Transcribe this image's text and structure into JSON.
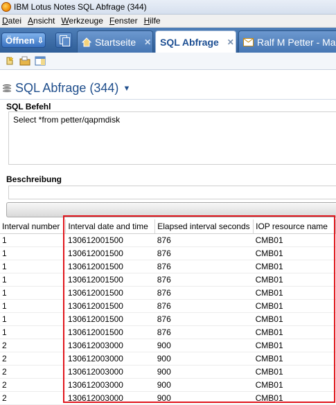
{
  "window": {
    "title": "IBM Lotus Notes SQL Abfrage (344)"
  },
  "menu": [
    {
      "underline": "D",
      "rest": "atei"
    },
    {
      "underline": "A",
      "rest": "nsicht"
    },
    {
      "underline": "W",
      "rest": "erkzeuge"
    },
    {
      "underline": "F",
      "rest": "enster"
    },
    {
      "underline": "H",
      "rest": "ilfe"
    }
  ],
  "toolbar": {
    "open_label": "Öffnen"
  },
  "tabs": [
    {
      "label": "Startseite",
      "icon": "home-icon",
      "active": false
    },
    {
      "label": "SQL Abfrage",
      "icon": "",
      "active": true
    },
    {
      "label": "Ralf M Petter - Mail",
      "icon": "mail-icon",
      "active": false
    }
  ],
  "view": {
    "title": "SQL Abfrage (344)",
    "sql_label": "SQL Befehl",
    "sql_text": "Select *from petter/qapmdisk",
    "description_label": "Beschreibung",
    "description_text": ""
  },
  "table": {
    "columns": [
      "Interval number",
      "Interval date and time",
      "Elapsed interval seconds",
      "IOP resource name"
    ],
    "rows": [
      [
        "1",
        "130612001500",
        "876",
        "CMB01"
      ],
      [
        "1",
        "130612001500",
        "876",
        "CMB01"
      ],
      [
        "1",
        "130612001500",
        "876",
        "CMB01"
      ],
      [
        "1",
        "130612001500",
        "876",
        "CMB01"
      ],
      [
        "1",
        "130612001500",
        "876",
        "CMB01"
      ],
      [
        "1",
        "130612001500",
        "876",
        "CMB01"
      ],
      [
        "1",
        "130612001500",
        "876",
        "CMB01"
      ],
      [
        "1",
        "130612001500",
        "876",
        "CMB01"
      ],
      [
        "2",
        "130612003000",
        "900",
        "CMB01"
      ],
      [
        "2",
        "130612003000",
        "900",
        "CMB01"
      ],
      [
        "2",
        "130612003000",
        "900",
        "CMB01"
      ],
      [
        "2",
        "130612003000",
        "900",
        "CMB01"
      ],
      [
        "2",
        "130612003000",
        "900",
        "CMB01"
      ]
    ]
  },
  "colors": {
    "highlight": "#e0141b",
    "tabbar": "#3a6aa8",
    "view_title": "#1f4e8c"
  }
}
